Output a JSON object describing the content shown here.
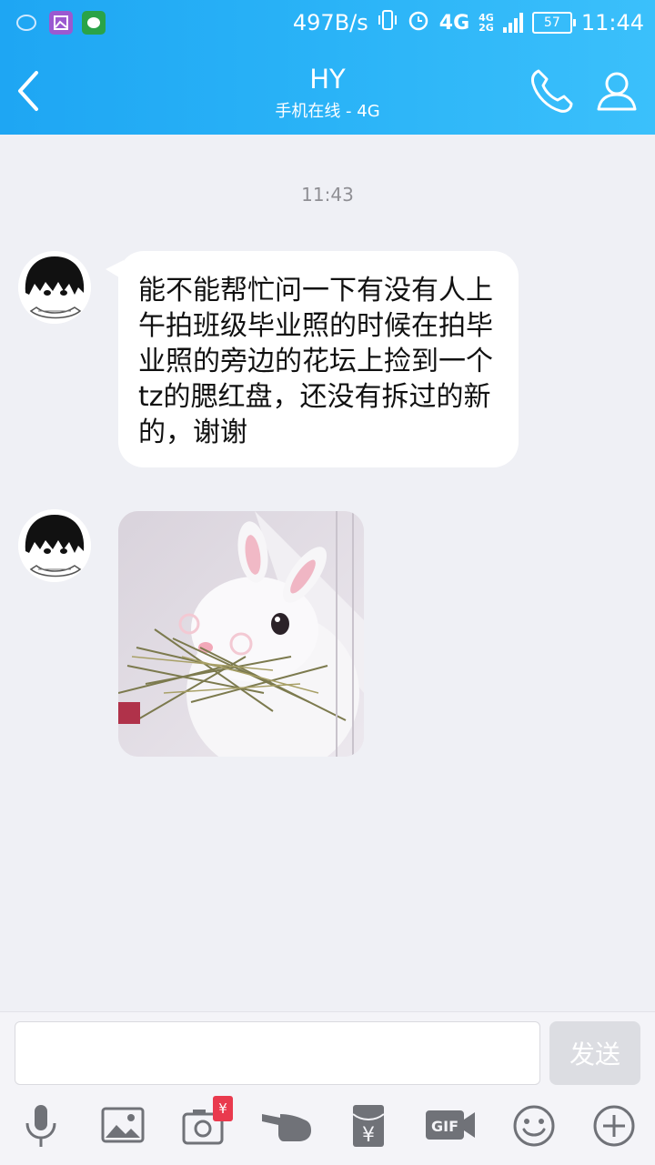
{
  "status_bar": {
    "speed": "497B/s",
    "network": "4G",
    "sim_labels": [
      "4G",
      "2G"
    ],
    "battery": "57",
    "time": "11:44"
  },
  "header": {
    "title": "HY",
    "subtitle": "手机在线 - 4G",
    "icons": [
      "back-icon",
      "phone-icon",
      "profile-icon"
    ]
  },
  "chat": {
    "timestamp": "11:43",
    "messages": [
      {
        "type": "text",
        "text": "能不能帮忙问一下有没有人上午拍班级毕业照的时候在拍毕业照的旁边的花坛上捡到一个tz的腮红盘，还没有拆过的新的，谢谢"
      },
      {
        "type": "image",
        "subject": "white rabbit eating hay"
      }
    ]
  },
  "input": {
    "value": "",
    "send_label": "发送"
  },
  "toolbar": {
    "items": [
      "mic-icon",
      "image-icon",
      "camera-icon",
      "poke-icon",
      "red-packet-icon",
      "gif-icon",
      "emoji-icon",
      "plus-icon"
    ],
    "badge": "¥",
    "gif_label": "GIF",
    "red_packet_symbol": "¥"
  },
  "colors": {
    "header_start": "#1ea6f3",
    "header_end": "#3bc0fb",
    "background": "#eff0f5",
    "icon_gray": "#707278"
  }
}
